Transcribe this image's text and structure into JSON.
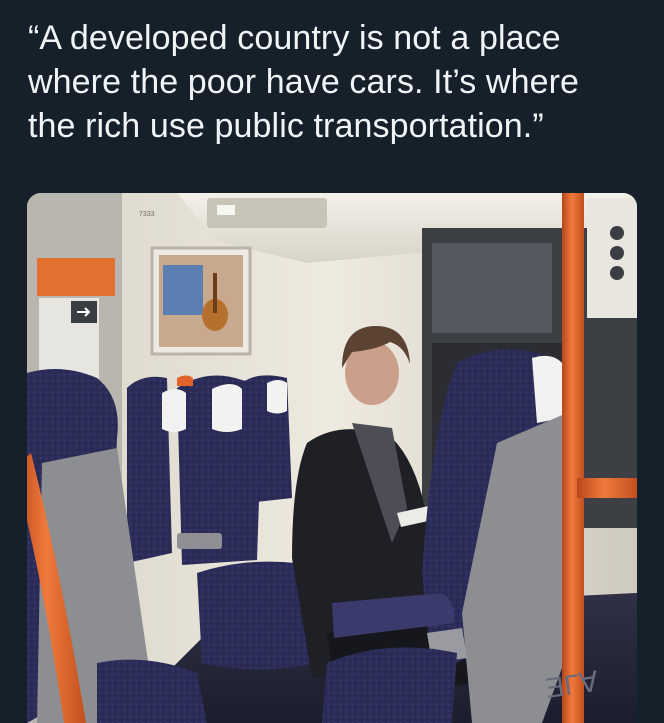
{
  "tweet": {
    "quote_lines": [
      "“A developed country is not a place",
      "where the poor have cars. It’s where",
      "the rich use public transportation.”"
    ]
  },
  "photo": {
    "description": "train-interior-passenger-photo",
    "seat_color": "#2e2f5c",
    "pole_color": "#e2632a",
    "wall_color": "#e9e4da"
  }
}
